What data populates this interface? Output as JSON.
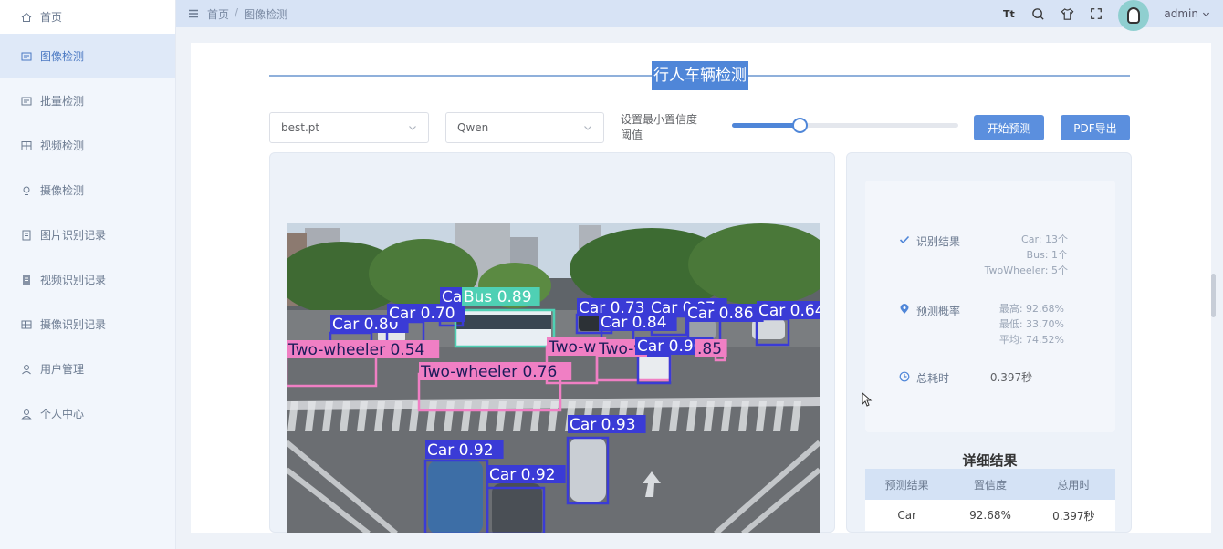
{
  "sidebar": {
    "items": [
      {
        "label": "首页",
        "icon": "home-icon"
      },
      {
        "label": "图像检测",
        "icon": "image-icon"
      },
      {
        "label": "批量检测",
        "icon": "batch-icon"
      },
      {
        "label": "视频检测",
        "icon": "video-icon"
      },
      {
        "label": "摄像检测",
        "icon": "camera-icon"
      },
      {
        "label": "图片识别记录",
        "icon": "record-icon"
      },
      {
        "label": "视频识别记录",
        "icon": "video-record-icon"
      },
      {
        "label": "摄像识别记录",
        "icon": "camera-record-icon"
      },
      {
        "label": "用户管理",
        "icon": "user-icon"
      },
      {
        "label": "个人中心",
        "icon": "person-icon"
      }
    ]
  },
  "header": {
    "breadcrumb": [
      "首页",
      "图像检测"
    ],
    "breadcrumb_sep": "/",
    "font_icon_text": "Tt",
    "username": "admin"
  },
  "main": {
    "title": "行人车辆检测",
    "model_select": "best.pt",
    "llm_select": "Qwen",
    "threshold_label": "设置最小置信度阈值",
    "threshold_value": 0.3,
    "start_button": "开始预测",
    "pdf_button": "PDF导出"
  },
  "detections": [
    {
      "label": "Car 0.80",
      "color": "#3a3bd6"
    },
    {
      "label": "Car 0.70",
      "color": "#3a3bd6"
    },
    {
      "label": "Car",
      "color": "#3a3bd6"
    },
    {
      "label": "Bus 0.89",
      "color": "#4fd0b4"
    },
    {
      "label": "Car 0.73",
      "color": "#3a3bd6"
    },
    {
      "label": "Car 0.84",
      "color": "#3a3bd6"
    },
    {
      "label": "Car 0.?7",
      "color": "#3a3bd6"
    },
    {
      "label": "Car 0.86",
      "color": "#3a3bd6"
    },
    {
      "label": "Car 0.64",
      "color": "#3a3bd6"
    },
    {
      "label": "Two-wheeler 0.54",
      "color": "#f07fc4"
    },
    {
      "label": "Two-wheeler 0.76",
      "color": "#f07fc4"
    },
    {
      "label": "Two-wh",
      "color": "#f07fc4"
    },
    {
      "label": "Two-w",
      "color": "#f07fc4"
    },
    {
      "label": "Car 0.90",
      "color": "#3a3bd6"
    },
    {
      "label": ".85",
      "color": "#f07fc4"
    },
    {
      "label": "Car 0.93",
      "color": "#3a3bd6"
    },
    {
      "label": "Car 0.92",
      "color": "#3a3bd6"
    },
    {
      "label": "Car 0.92",
      "color": "#3a3bd6"
    }
  ],
  "results": {
    "recognition_label": "识别结果",
    "counts": [
      "Car:  13个",
      "Bus:  1个",
      "TwoWheeler:  5个"
    ],
    "probability_label": "预测概率",
    "probabilities": [
      "最高:  92.68%",
      "最低:  33.70%",
      "平均:  74.52%"
    ],
    "time_label": "总耗时",
    "time_value": "0.397秒"
  },
  "detail": {
    "title": "详细结果",
    "columns": [
      "预测结果",
      "置信度",
      "总用时"
    ],
    "rows": [
      [
        "Car",
        "92.68%",
        "0.397秒"
      ]
    ]
  },
  "colors": {
    "accent": "#4f86d8",
    "sidebar_active_bg": "#dfe9f8",
    "header_bg": "#d7e3f5",
    "car_box": "#3a3bd6",
    "twowheeler_box": "#f07fc4",
    "bus_box": "#4fd0b4"
  }
}
